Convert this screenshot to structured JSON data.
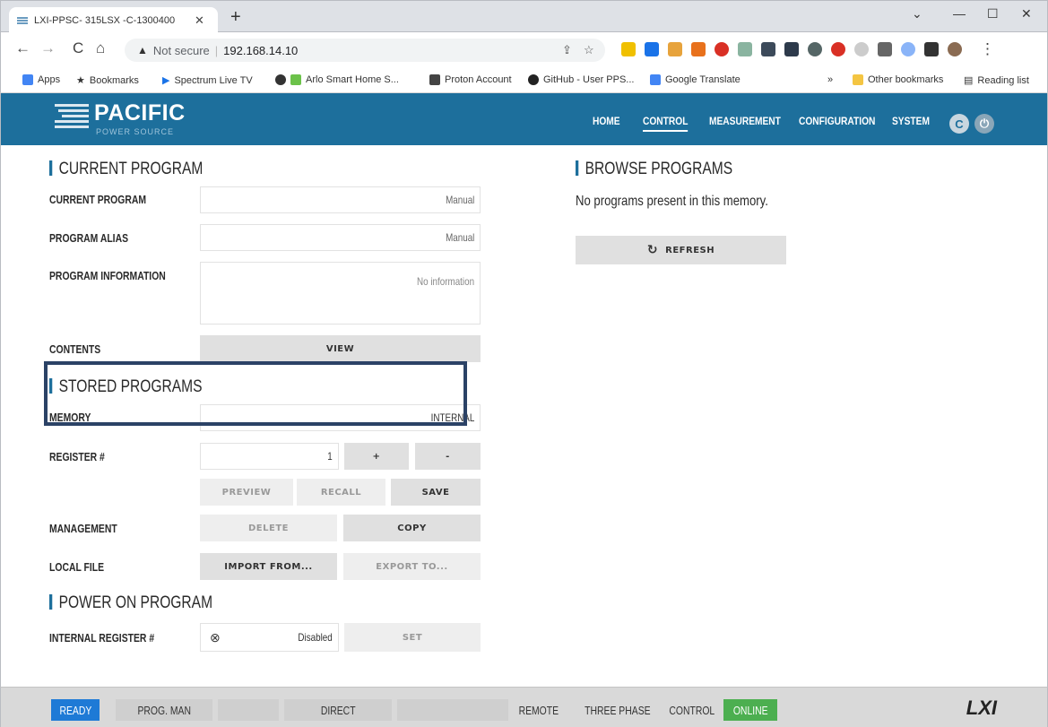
{
  "browser": {
    "tab_title": "LXI-PPSC- 315LSX -C-1300400",
    "security_label": "Not secure",
    "url": "192.168.14.10",
    "bookmarks": [
      "Apps",
      "Bookmarks",
      "Spectrum Live TV",
      "Arlo Smart Home S...",
      "Proton Account",
      "GitHub - User PPS...",
      "Google Translate"
    ],
    "other_bookmarks": "Other bookmarks",
    "reading_list": "Reading list",
    "overflow": "»"
  },
  "app": {
    "logo_brand": "PACIFIC",
    "logo_sub": "POWER SOURCE",
    "nav": [
      "HOME",
      "CONTROL",
      "MEASUREMENT",
      "CONFIGURATION",
      "SYSTEM"
    ],
    "active_nav": "CONTROL"
  },
  "current_program": {
    "title": "CURRENT PROGRAM",
    "current_program_label": "CURRENT PROGRAM",
    "current_program_value": "Manual",
    "alias_label": "PROGRAM ALIAS",
    "alias_value": "Manual",
    "info_label": "PROGRAM INFORMATION",
    "info_placeholder": "No information",
    "contents_label": "CONTENTS",
    "view_button": "VIEW"
  },
  "stored_programs": {
    "title": "STORED PROGRAMS",
    "memory_label": "MEMORY",
    "memory_value": "INTERNAL",
    "register_label": "REGISTER #",
    "register_value": "1",
    "plus": "+",
    "minus": "-",
    "preview": "PREVIEW",
    "recall": "RECALL",
    "save": "SAVE",
    "management_label": "MANAGEMENT",
    "delete": "DELETE",
    "copy": "COPY",
    "local_file_label": "LOCAL FILE",
    "import": "IMPORT FROM...",
    "export": "EXPORT TO..."
  },
  "power_on": {
    "title": "POWER ON PROGRAM",
    "register_label": "INTERNAL REGISTER #",
    "register_value": "Disabled",
    "set": "SET"
  },
  "browse": {
    "title": "BROWSE PROGRAMS",
    "message": "No programs present in this memory.",
    "refresh": "REFRESH"
  },
  "status": {
    "ready": "READY",
    "prog_man": "PROG. MAN",
    "direct": "DIRECT",
    "remote": "REMOTE",
    "three_phase": "THREE PHASE",
    "control": "CONTROL",
    "online": "ONLINE",
    "lxi": "LXI"
  },
  "colors": {
    "header": "#1d6f9c",
    "ready": "#1e7ad6",
    "online": "#4caf50",
    "highlight": "#2b4266"
  }
}
